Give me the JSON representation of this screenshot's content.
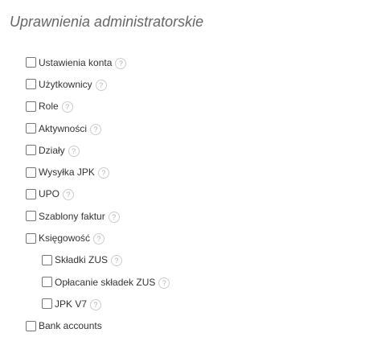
{
  "section": {
    "title": "Uprawnienia administratorskie"
  },
  "help_icon": {
    "glyph": "?",
    "icon": "question-mark-icon"
  },
  "permissions": [
    {
      "label": "Ustawienia konta",
      "checked": false,
      "level": 0
    },
    {
      "label": "Użytkownicy",
      "checked": false,
      "level": 0
    },
    {
      "label": "Role",
      "checked": false,
      "level": 0
    },
    {
      "label": "Aktywności",
      "checked": false,
      "level": 0
    },
    {
      "label": "Działy",
      "checked": false,
      "level": 0
    },
    {
      "label": "Wysyłka JPK",
      "checked": false,
      "level": 0
    },
    {
      "label": "UPO",
      "checked": false,
      "level": 0
    },
    {
      "label": "Szablony faktur",
      "checked": false,
      "level": 0
    },
    {
      "label": "Księgowość",
      "checked": false,
      "level": 0
    },
    {
      "label": "Składki ZUS",
      "checked": false,
      "level": 1
    },
    {
      "label": "Opłacanie składek ZUS",
      "checked": false,
      "level": 1
    },
    {
      "label": "JPK V7",
      "checked": false,
      "level": 1
    },
    {
      "label": "Bank accounts",
      "checked": false,
      "level": 0
    }
  ]
}
